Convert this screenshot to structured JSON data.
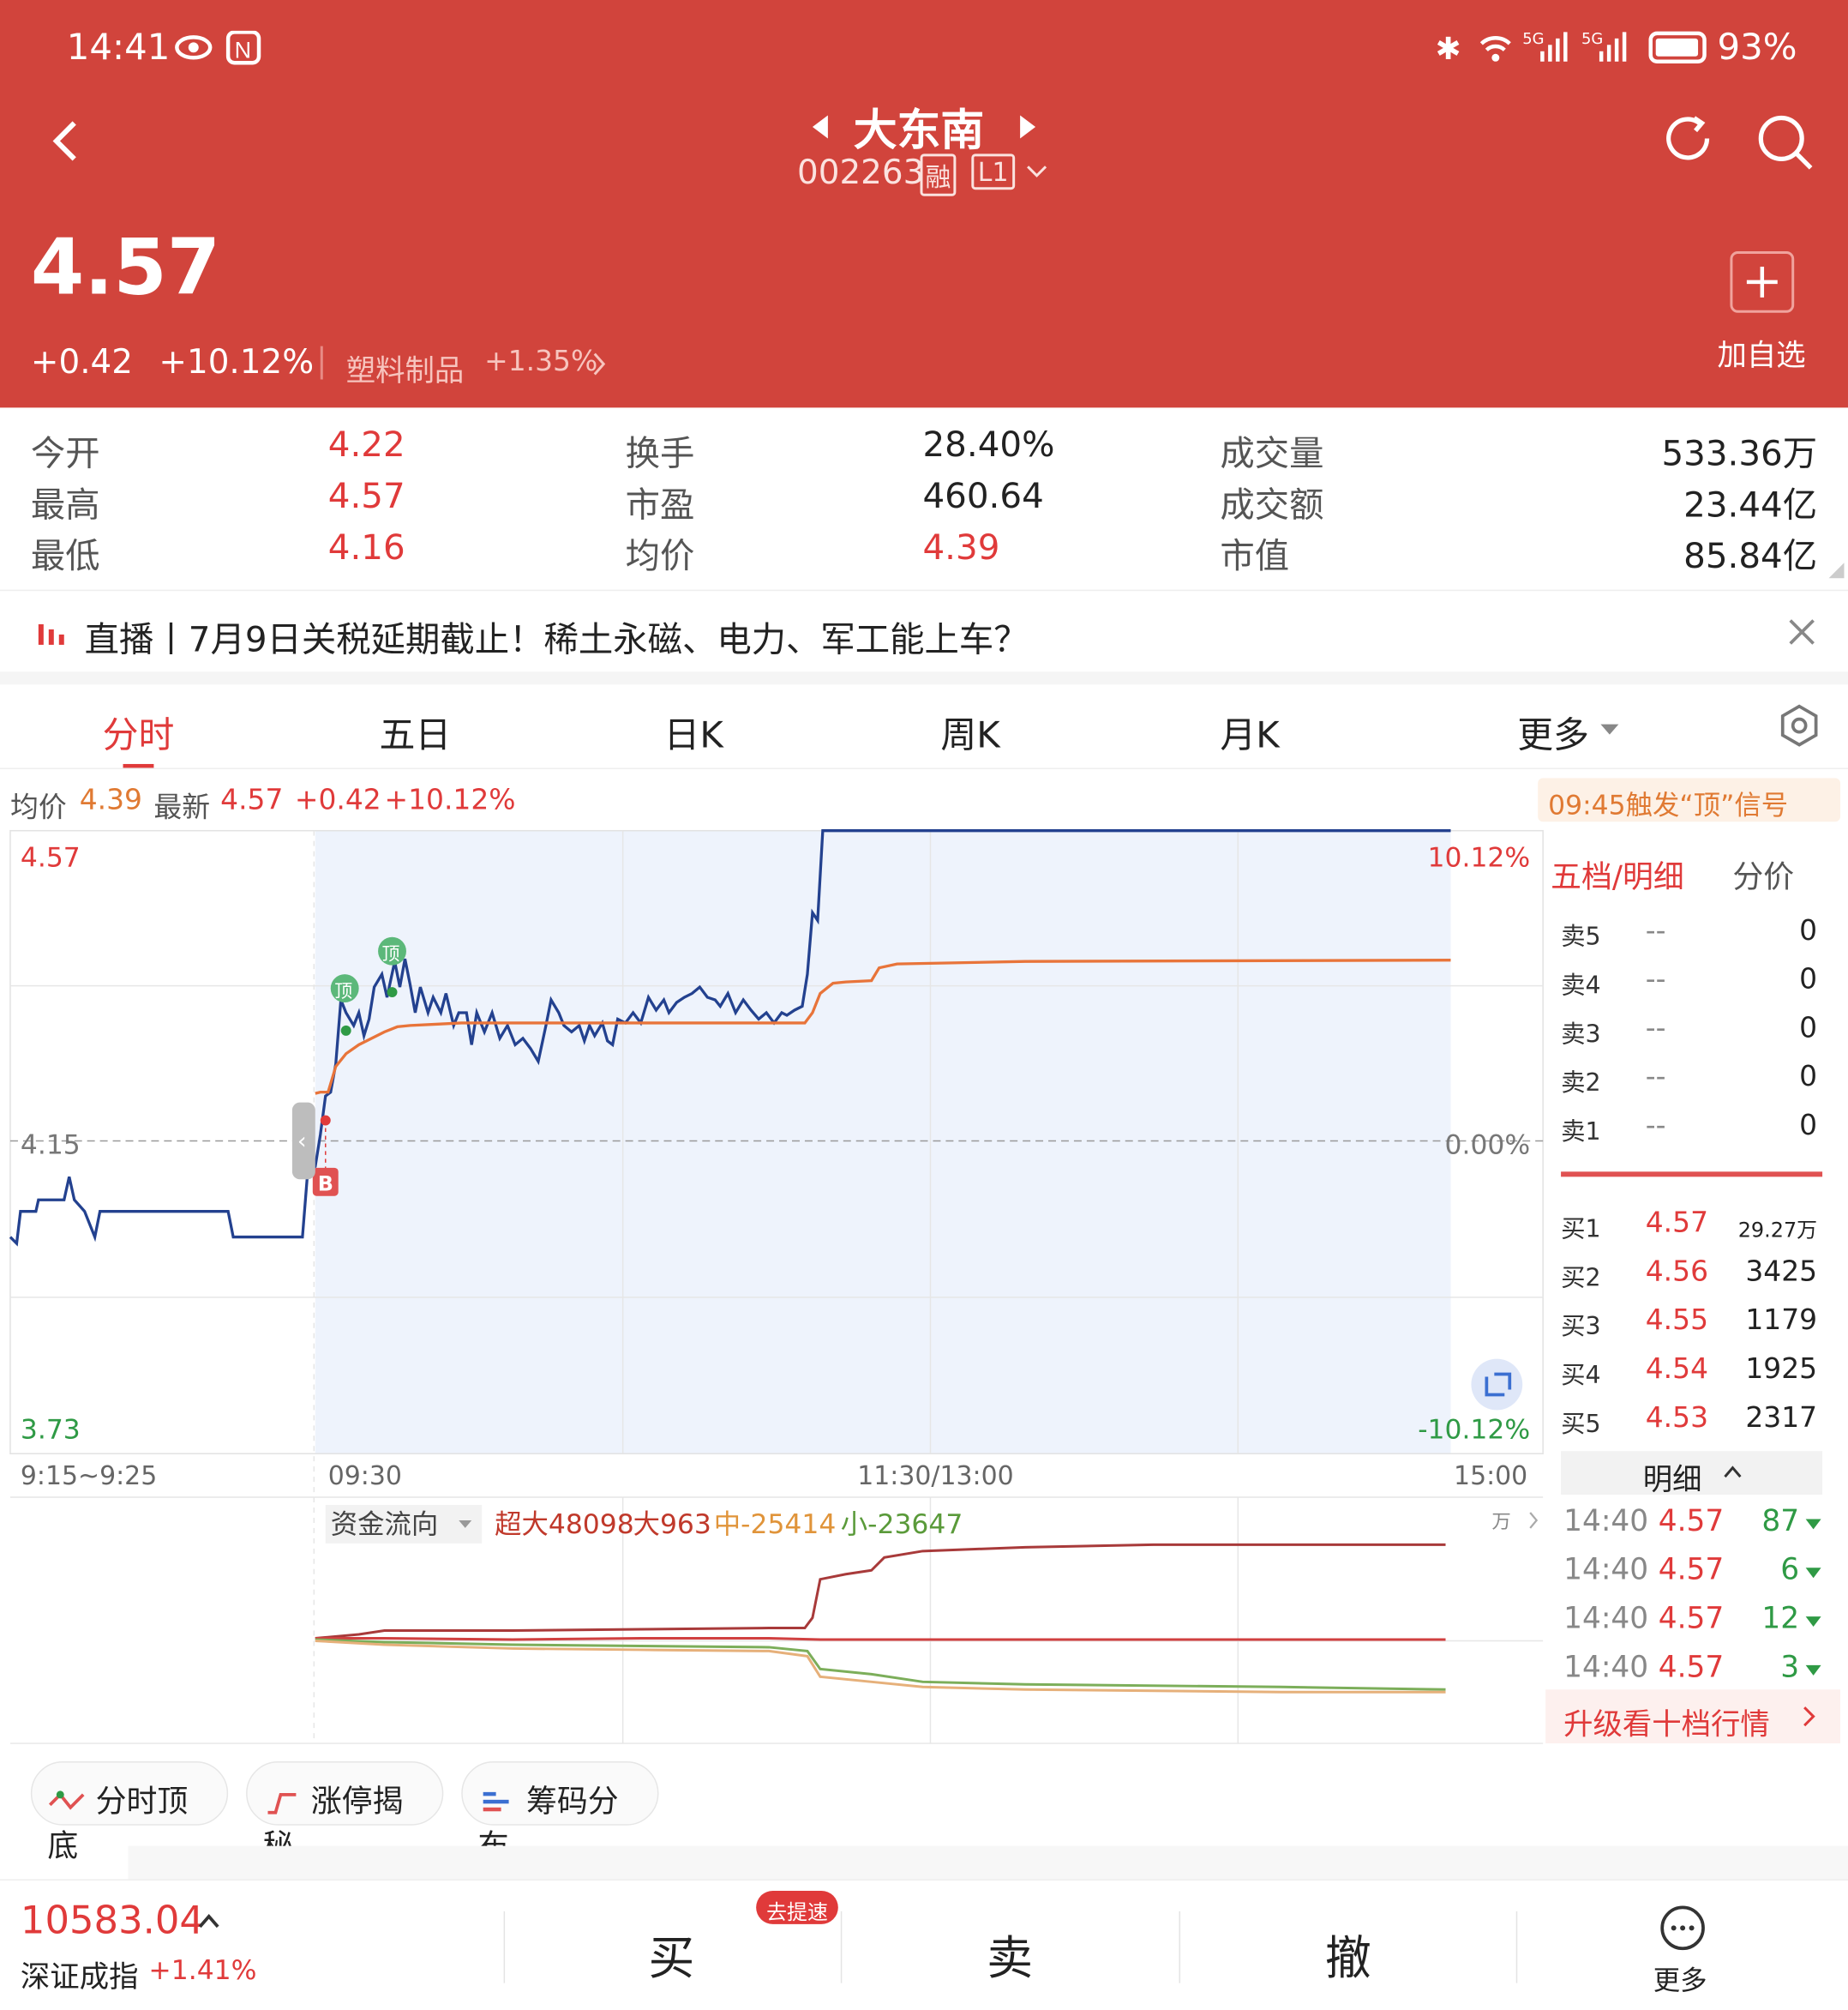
{
  "status": {
    "time": "14:41",
    "battery": "93%",
    "signal1": "5G",
    "signal2": "5G"
  },
  "header": {
    "name": "大东南",
    "code": "002263",
    "tag1": "融",
    "tag2": "L1"
  },
  "quote": {
    "price": "4.57",
    "change": "+0.42",
    "change_pct": "+10.12%",
    "sector": "塑料制品",
    "sector_pct": "+1.35%",
    "add_label": "加自选"
  },
  "stats": {
    "open_label": "今开",
    "open": "4.22",
    "high_label": "最高",
    "high": "4.57",
    "low_label": "最低",
    "low": "4.16",
    "turnover_label": "换手",
    "turnover": "28.40%",
    "pe_label": "市盈",
    "pe": "460.64",
    "avg_label": "均价",
    "avg": "4.39",
    "vol_label": "成交量",
    "vol": "533.36万",
    "amount_label": "成交额",
    "amount": "23.44亿",
    "cap_label": "市值",
    "cap": "85.84亿"
  },
  "news": {
    "text": "直播丨7月9日关税延期截止！稀土永磁、电力、军工能上车？"
  },
  "tabs": [
    "分时",
    "五日",
    "日K",
    "周K",
    "月K",
    "更多"
  ],
  "info": {
    "avg_label": "均价",
    "avg": "4.39",
    "last_label": "最新",
    "last": "4.57",
    "chg": "+0.42",
    "pct": "+10.12%",
    "signal": "09:45触发“顶”信号"
  },
  "chart_labels": {
    "top_price": "4.57",
    "mid_price": "4.15",
    "bottom_price": "3.73",
    "top_pct": "10.12%",
    "mid_pct": "0.00%",
    "bottom_pct": "-10.12%",
    "t0": "9:15~9:25",
    "t1": "09:30",
    "t2": "11:30/13:00",
    "t3": "15:00",
    "top_marker": "顶",
    "buy_marker": "B"
  },
  "flow": {
    "selector": "资金流向",
    "super": "超大48098",
    "big": "大963",
    "mid": "中-25414",
    "small": "小-23647",
    "unit": "万"
  },
  "orderbook": {
    "tab1": "五档/明细",
    "tab2": "分价",
    "sells": [
      {
        "l": "卖5",
        "p": "--",
        "v": "0"
      },
      {
        "l": "卖4",
        "p": "--",
        "v": "0"
      },
      {
        "l": "卖3",
        "p": "--",
        "v": "0"
      },
      {
        "l": "卖2",
        "p": "--",
        "v": "0"
      },
      {
        "l": "卖1",
        "p": "--",
        "v": "0"
      }
    ],
    "buys": [
      {
        "l": "买1",
        "p": "4.57",
        "v": "29.27万"
      },
      {
        "l": "买2",
        "p": "4.56",
        "v": "3425"
      },
      {
        "l": "买3",
        "p": "4.55",
        "v": "1179"
      },
      {
        "l": "买4",
        "p": "4.54",
        "v": "1925"
      },
      {
        "l": "买5",
        "p": "4.53",
        "v": "2317"
      }
    ],
    "detail_label": "明细",
    "details": [
      {
        "t": "14:40",
        "p": "4.57",
        "v": "87"
      },
      {
        "t": "14:40",
        "p": "4.57",
        "v": "6"
      },
      {
        "t": "14:40",
        "p": "4.57",
        "v": "12"
      },
      {
        "t": "14:40",
        "p": "4.57",
        "v": "3"
      }
    ],
    "upgrade": "升级看十档行情"
  },
  "chips": [
    "分时顶底",
    "涨停揭秘",
    "筹码分布"
  ],
  "bottom": {
    "index_value": "10583.04",
    "index_name": "深证成指",
    "index_pct": "+1.41%",
    "buy": "买",
    "sell": "卖",
    "cancel": "撤",
    "more": "更多",
    "badge": "去提速"
  }
}
